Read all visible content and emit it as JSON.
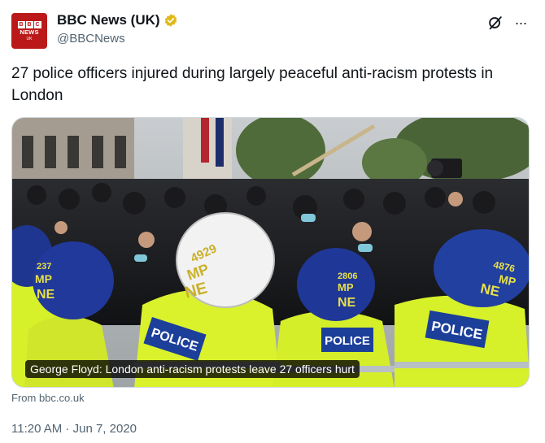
{
  "author": {
    "display_name": "BBC News (UK)",
    "handle": "@BBCNews",
    "avatar_text": "BBC NEWS",
    "avatar_letters": [
      "B",
      "B",
      "C"
    ],
    "avatar_sub": "UK",
    "verified": true,
    "verified_color": "#e2b719"
  },
  "actions": {
    "grok_icon": "grok-icon",
    "more_icon": "more-icon",
    "more_label": "···"
  },
  "tweet": {
    "text": "27 police officers injured during largely peaceful anti-racism protests in London"
  },
  "card": {
    "caption": "George Floyd: London anti-racism protests leave 27 officers hurt",
    "source": "From bbc.co.uk",
    "helmet_numbers": [
      "4929",
      "2806",
      "4876",
      "237"
    ],
    "helmet_labels": [
      "MP",
      "NE"
    ],
    "vest_text": "POLICE"
  },
  "meta": {
    "time": "11:20 AM",
    "separator": " · ",
    "date": "Jun 7, 2020"
  },
  "colors": {
    "brand_red": "#bb1919",
    "text_primary": "#0f1419",
    "text_secondary": "#536471",
    "border": "#cfd9de",
    "hi_vis": "#d6f02a",
    "police_blue": "#1c3f9a"
  }
}
